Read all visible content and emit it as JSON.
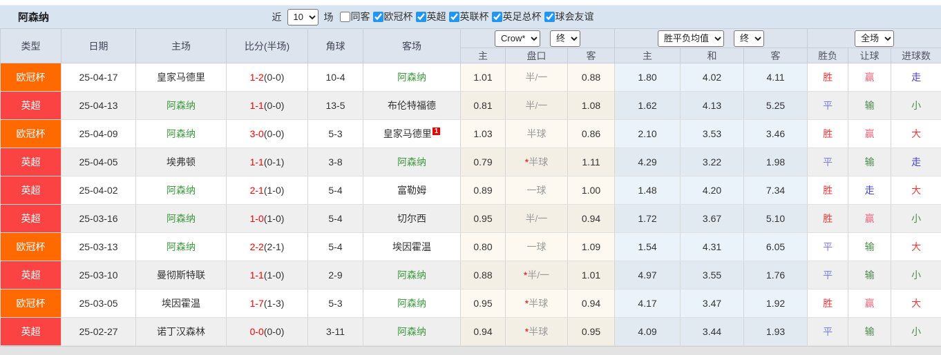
{
  "header": {
    "team_title": "阿森纳",
    "recent_prefix": "近",
    "recent_suffix": "场",
    "selects": {
      "count": "10"
    },
    "filters": [
      {
        "label": "同客",
        "checked": false
      },
      {
        "label": "欧冠杯",
        "checked": true
      },
      {
        "label": "英超",
        "checked": true
      },
      {
        "label": "英联杯",
        "checked": true
      },
      {
        "label": "英足总杯",
        "checked": true
      },
      {
        "label": "球会友谊",
        "checked": true
      }
    ]
  },
  "table": {
    "selects": {
      "bookmaker": "Crow*",
      "bookmaker_time": "终",
      "avg_type": "胜平负均值",
      "avg_time": "终",
      "period": "全场"
    },
    "col_headers_left": [
      "类型",
      "日期",
      "主场",
      "比分(半场)",
      "角球",
      "客场"
    ],
    "sub_headers": [
      "主",
      "盘口",
      "客",
      "主",
      "和",
      "客",
      "胜负",
      "让球",
      "进球数"
    ],
    "colors": {
      "ucl_orange": "#ff6a00",
      "epl_red": "#fc4343",
      "self_team_green": "#3d9a3d",
      "score_red": "#ff0000",
      "badge_red": "#e60000",
      "checkbox_blue": "#2196f3"
    },
    "rows": [
      {
        "comp": "欧冠杯",
        "comp_color": "#ff6a00",
        "date": "25-04-17",
        "home": {
          "name": "皇家马德里",
          "self": false
        },
        "score": {
          "ft": "1-2",
          "ht": "(0-0)"
        },
        "corner": "10-4",
        "away": {
          "name": "阿森纳",
          "self": true,
          "badge": ""
        },
        "crow": {
          "home": "1.01",
          "handicap": "半/一",
          "star": false,
          "away": "0.88"
        },
        "avg": {
          "home": "1.80",
          "draw": "4.02",
          "away": "4.11"
        },
        "result": {
          "wdl": {
            "text": "胜",
            "color": "red"
          },
          "handicap": {
            "text": "赢",
            "color": "pink"
          },
          "goals": {
            "text": "走",
            "color": "blue"
          }
        }
      },
      {
        "comp": "英超",
        "comp_color": "#fc4343",
        "date": "25-04-13",
        "home": {
          "name": "阿森纳",
          "self": true
        },
        "score": {
          "ft": "1-1",
          "ht": "(0-0)"
        },
        "corner": "13-5",
        "away": {
          "name": "布伦特福德",
          "self": false,
          "badge": ""
        },
        "crow": {
          "home": "0.81",
          "handicap": "半/一",
          "star": false,
          "away": "1.08"
        },
        "avg": {
          "home": "1.62",
          "draw": "4.13",
          "away": "5.25"
        },
        "result": {
          "wdl": {
            "text": "平",
            "color": "blueL"
          },
          "handicap": {
            "text": "输",
            "color": "green"
          },
          "goals": {
            "text": "小",
            "color": "green"
          }
        }
      },
      {
        "comp": "欧冠杯",
        "comp_color": "#ff6a00",
        "date": "25-04-09",
        "home": {
          "name": "阿森纳",
          "self": true
        },
        "score": {
          "ft": "3-0",
          "ht": "(0-0)"
        },
        "corner": "5-3",
        "away": {
          "name": "皇家马德里",
          "self": false,
          "badge": "1"
        },
        "crow": {
          "home": "1.03",
          "handicap": "半球",
          "star": false,
          "away": "0.86"
        },
        "avg": {
          "home": "2.10",
          "draw": "3.53",
          "away": "3.46"
        },
        "result": {
          "wdl": {
            "text": "胜",
            "color": "red"
          },
          "handicap": {
            "text": "赢",
            "color": "pink"
          },
          "goals": {
            "text": "大",
            "color": "red"
          }
        }
      },
      {
        "comp": "英超",
        "comp_color": "#fc4343",
        "date": "25-04-05",
        "home": {
          "name": "埃弗顿",
          "self": false
        },
        "score": {
          "ft": "1-1",
          "ht": "(0-1)"
        },
        "corner": "3-8",
        "away": {
          "name": "阿森纳",
          "self": true,
          "badge": ""
        },
        "crow": {
          "home": "0.79",
          "handicap": "半球",
          "star": true,
          "away": "1.11"
        },
        "avg": {
          "home": "4.29",
          "draw": "3.22",
          "away": "1.98"
        },
        "result": {
          "wdl": {
            "text": "平",
            "color": "blueL"
          },
          "handicap": {
            "text": "输",
            "color": "green"
          },
          "goals": {
            "text": "走",
            "color": "blue"
          }
        }
      },
      {
        "comp": "英超",
        "comp_color": "#fc4343",
        "date": "25-04-02",
        "home": {
          "name": "阿森纳",
          "self": true
        },
        "score": {
          "ft": "2-1",
          "ht": "(1-0)"
        },
        "corner": "5-4",
        "away": {
          "name": "富勒姆",
          "self": false,
          "badge": ""
        },
        "crow": {
          "home": "0.89",
          "handicap": "一球",
          "star": false,
          "away": "1.00"
        },
        "avg": {
          "home": "1.48",
          "draw": "4.20",
          "away": "7.34"
        },
        "result": {
          "wdl": {
            "text": "胜",
            "color": "red"
          },
          "handicap": {
            "text": "走",
            "color": "blue"
          },
          "goals": {
            "text": "大",
            "color": "red"
          }
        }
      },
      {
        "comp": "英超",
        "comp_color": "#fc4343",
        "date": "25-03-16",
        "home": {
          "name": "阿森纳",
          "self": true
        },
        "score": {
          "ft": "1-0",
          "ht": "(1-0)"
        },
        "corner": "5-4",
        "away": {
          "name": "切尔西",
          "self": false,
          "badge": ""
        },
        "crow": {
          "home": "0.95",
          "handicap": "半/一",
          "star": false,
          "away": "0.94"
        },
        "avg": {
          "home": "1.72",
          "draw": "3.67",
          "away": "5.10"
        },
        "result": {
          "wdl": {
            "text": "胜",
            "color": "red"
          },
          "handicap": {
            "text": "赢",
            "color": "pink"
          },
          "goals": {
            "text": "小",
            "color": "green"
          }
        }
      },
      {
        "comp": "欧冠杯",
        "comp_color": "#ff6a00",
        "date": "25-03-13",
        "home": {
          "name": "阿森纳",
          "self": true
        },
        "score": {
          "ft": "2-2",
          "ht": "(2-1)"
        },
        "corner": "5-4",
        "away": {
          "name": "埃因霍温",
          "self": false,
          "badge": ""
        },
        "crow": {
          "home": "0.80",
          "handicap": "一球",
          "star": false,
          "away": "1.09"
        },
        "avg": {
          "home": "1.54",
          "draw": "4.31",
          "away": "6.05"
        },
        "result": {
          "wdl": {
            "text": "平",
            "color": "blueL"
          },
          "handicap": {
            "text": "输",
            "color": "green"
          },
          "goals": {
            "text": "大",
            "color": "red"
          }
        }
      },
      {
        "comp": "英超",
        "comp_color": "#fc4343",
        "date": "25-03-10",
        "home": {
          "name": "曼彻斯特联",
          "self": false
        },
        "score": {
          "ft": "1-1",
          "ht": "(1-0)"
        },
        "corner": "2-9",
        "away": {
          "name": "阿森纳",
          "self": true,
          "badge": ""
        },
        "crow": {
          "home": "0.88",
          "handicap": "半/一",
          "star": true,
          "away": "1.01"
        },
        "avg": {
          "home": "4.97",
          "draw": "3.55",
          "away": "1.76"
        },
        "result": {
          "wdl": {
            "text": "平",
            "color": "blueL"
          },
          "handicap": {
            "text": "输",
            "color": "green"
          },
          "goals": {
            "text": "小",
            "color": "green"
          }
        }
      },
      {
        "comp": "欧冠杯",
        "comp_color": "#ff6a00",
        "date": "25-03-05",
        "home": {
          "name": "埃因霍温",
          "self": false
        },
        "score": {
          "ft": "1-7",
          "ht": "(1-3)"
        },
        "corner": "5-3",
        "away": {
          "name": "阿森纳",
          "self": true,
          "badge": ""
        },
        "crow": {
          "home": "0.95",
          "handicap": "半球",
          "star": true,
          "away": "0.94"
        },
        "avg": {
          "home": "4.17",
          "draw": "3.47",
          "away": "1.92"
        },
        "result": {
          "wdl": {
            "text": "胜",
            "color": "red"
          },
          "handicap": {
            "text": "赢",
            "color": "pink"
          },
          "goals": {
            "text": "大",
            "color": "red"
          }
        }
      },
      {
        "comp": "英超",
        "comp_color": "#fc4343",
        "date": "25-02-27",
        "home": {
          "name": "诺丁汉森林",
          "self": false
        },
        "score": {
          "ft": "0-0",
          "ht": "(0-0)"
        },
        "corner": "3-11",
        "away": {
          "name": "阿森纳",
          "self": true,
          "badge": ""
        },
        "crow": {
          "home": "0.94",
          "handicap": "半球",
          "star": true,
          "away": "0.95"
        },
        "avg": {
          "home": "4.09",
          "draw": "3.44",
          "away": "1.93"
        },
        "result": {
          "wdl": {
            "text": "平",
            "color": "blueL"
          },
          "handicap": {
            "text": "输",
            "color": "green"
          },
          "goals": {
            "text": "小",
            "color": "green"
          }
        }
      }
    ]
  }
}
